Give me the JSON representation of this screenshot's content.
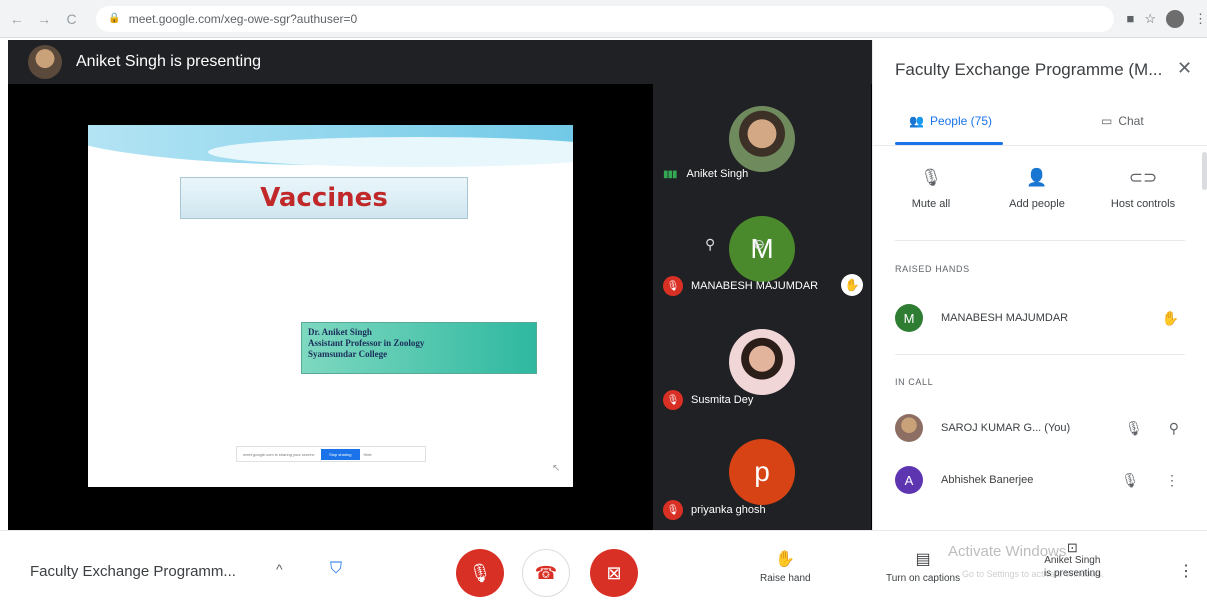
{
  "browser": {
    "url": "meet.google.com/xeg-owe-sgr?authuser=0",
    "back_icon": "←",
    "forward_icon": "→",
    "reload_icon": "C"
  },
  "stage": {
    "presenter_text": "Aniket Singh is presenting"
  },
  "slide": {
    "title": "Vaccines",
    "author_lines": [
      "Dr. Aniket Singh",
      "Assistant Professor in Zoology",
      "Syamsundar College"
    ],
    "share_text": "meet.google.com is sharing your screen.",
    "stop_label": "Stop sharing",
    "hide_label": "Hide"
  },
  "tiles": [
    {
      "name": "Aniket Singh",
      "status": "speaking"
    },
    {
      "name": "MANABESH MAJUMDAR",
      "initial": "M",
      "avatar_color": "#4a8a2c",
      "status": "muted",
      "hand_raised": true
    },
    {
      "name": "Susmita Dey",
      "status": "muted"
    },
    {
      "name": "priyanka ghosh",
      "initial": "p",
      "avatar_color": "#d84315",
      "status": "muted"
    }
  ],
  "panel": {
    "title": "Faculty Exchange Programme (M...",
    "tabs": {
      "people": "People (75)",
      "chat": "Chat"
    },
    "actions": {
      "mute_all": "Mute all",
      "add_people": "Add people",
      "host_controls": "Host controls"
    },
    "raised_hands_label": "RAISED HANDS",
    "raised_hands": [
      {
        "name": "MANABESH MAJUMDAR",
        "initial": "M",
        "color": "#2e7d32"
      }
    ],
    "in_call_label": "IN CALL",
    "in_call": [
      {
        "name": "SAROJ KUMAR G...  (You)",
        "color": "#8d6e63"
      },
      {
        "name": "Abhishek Banerjee",
        "initial": "A",
        "color": "#5e35b1"
      }
    ]
  },
  "bottom": {
    "meeting_name": "Faculty Exchange Programm...",
    "raise_hand": "Raise hand",
    "captions": "Turn on captions",
    "watermark_title": "Activate Windows",
    "watermark_sub": "Go to Settings to activate Windows.",
    "presenting_name": "Aniket Singh",
    "presenting_label": "is presenting"
  },
  "colors": {
    "accent": "#1a73e8",
    "danger": "#d93025",
    "dark_bg": "#202124"
  }
}
